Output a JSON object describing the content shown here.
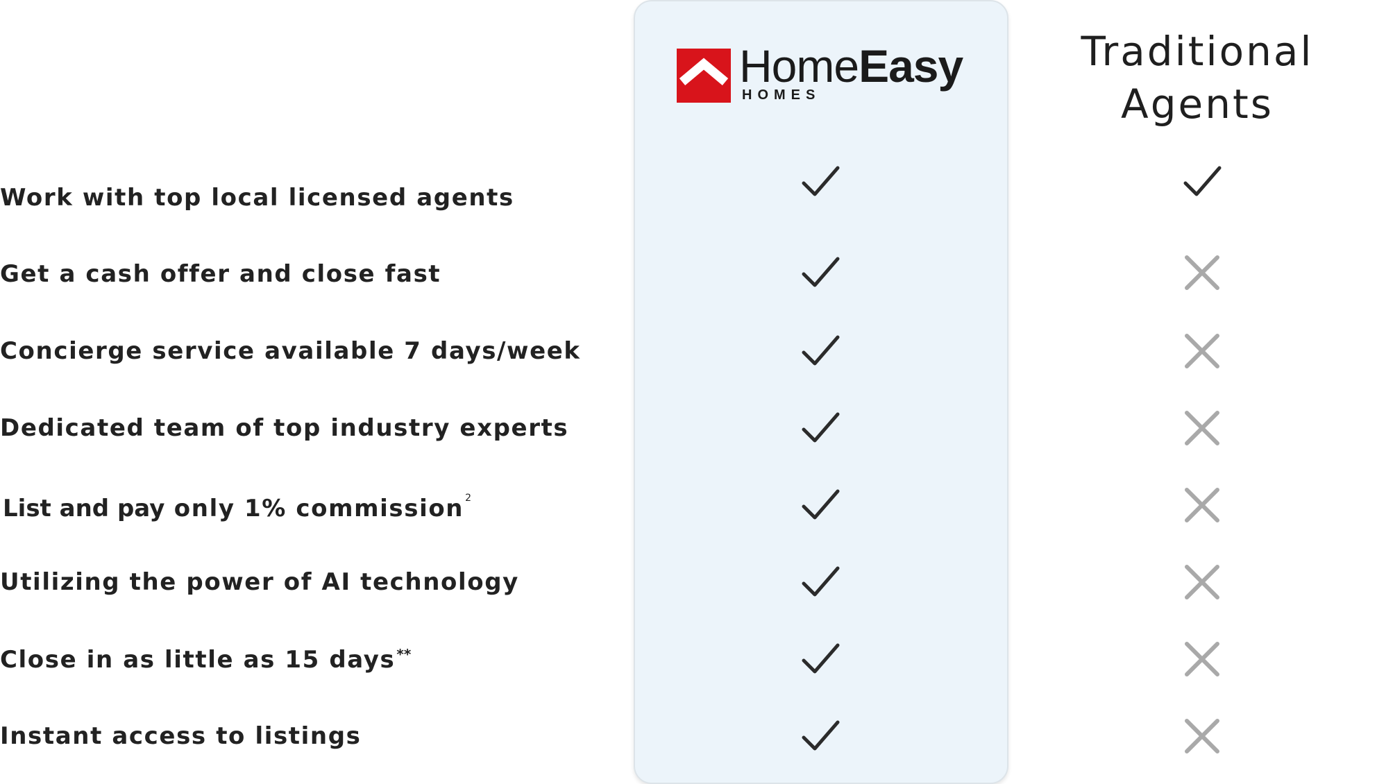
{
  "brand": {
    "name_light": "Home",
    "name_bold": "Easy",
    "sub": "HOMES",
    "logo_color": "#d8141b",
    "panel_color": "#ecf4fa"
  },
  "competitor": {
    "line1": "Traditional",
    "line2": "Agents"
  },
  "features": [
    {
      "label": "Work with top local licensed agents",
      "homeeasy": "check-icon",
      "traditional": "check-icon"
    },
    {
      "label": "Get a cash offer and close fast",
      "homeeasy": "check-icon",
      "traditional": "x-icon"
    },
    {
      "label": "Concierge service available 7 days/week",
      "homeeasy": "check-icon",
      "traditional": "x-icon"
    },
    {
      "label": "Dedicated team of top industry experts",
      "homeeasy": "check-icon",
      "traditional": "x-icon"
    },
    {
      "label_lead": "List and pay",
      "label_rest": " only 1% commission",
      "footnote": "2",
      "homeeasy": "check-icon",
      "traditional": "x-icon"
    },
    {
      "label": "Utilizing the power of AI technology",
      "homeeasy": "check-icon",
      "traditional": "x-icon"
    },
    {
      "label": "Close in as little as 15 days",
      "footnote": "**",
      "homeeasy": "check-icon",
      "traditional": "x-icon"
    },
    {
      "label": "Instant access to listings",
      "homeeasy": "check-icon",
      "traditional": "x-icon"
    }
  ],
  "colors": {
    "check": "#2b2b2b",
    "x": "#a9a9a9"
  }
}
